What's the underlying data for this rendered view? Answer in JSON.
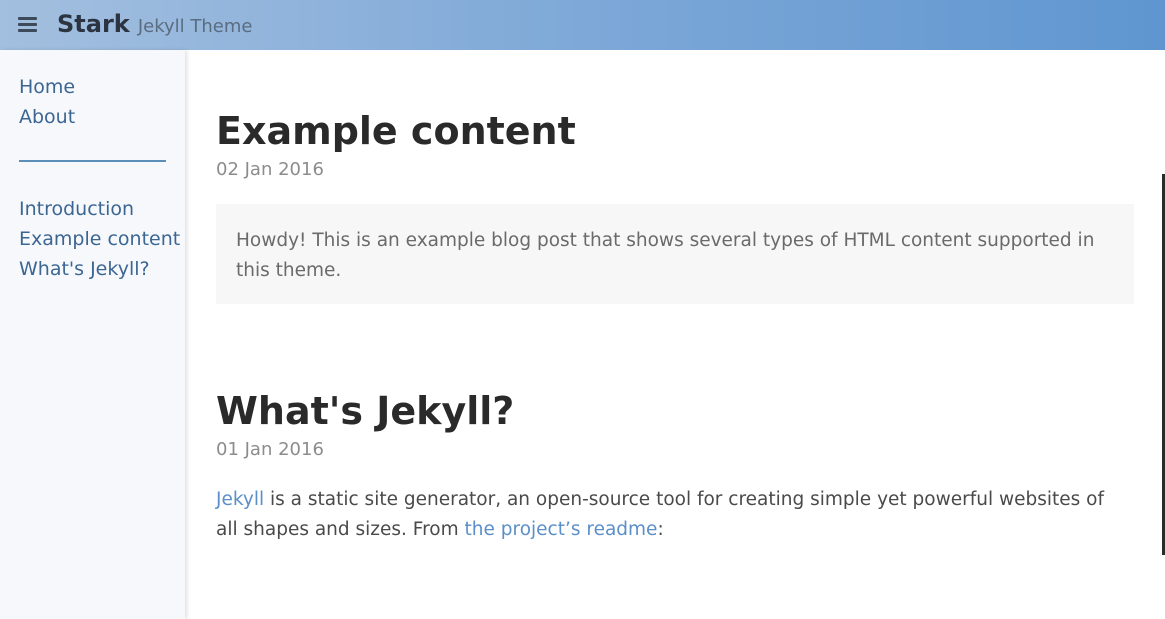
{
  "header": {
    "brand_name": "Stark",
    "brand_subtitle": "Jekyll Theme",
    "menu_icon": "hamburger-icon"
  },
  "sidebar": {
    "main_links": [
      {
        "label": "Home"
      },
      {
        "label": "About"
      }
    ],
    "post_links": [
      {
        "label": "Introduction"
      },
      {
        "label": "Example content"
      },
      {
        "label": "What's Jekyll?"
      }
    ]
  },
  "posts": [
    {
      "title": "Example content",
      "date": "02 Jan 2016",
      "excerpt": "Howdy! This is an example blog post that shows several types of HTML content supported in this theme."
    },
    {
      "title": "What's Jekyll?",
      "date": "01 Jan 2016",
      "body": {
        "link1": "Jekyll",
        "text1": " is a static site generator, an open-source tool for creating simple yet powerful websites of all shapes and sizes. From ",
        "link2": "the project’s readme",
        "text2": ":"
      }
    }
  ],
  "colors": {
    "accent": "#5b8fc9",
    "sidebar_link": "#3c6692",
    "topbar_start": "#a3bfdf",
    "topbar_end": "#5f96d0"
  }
}
